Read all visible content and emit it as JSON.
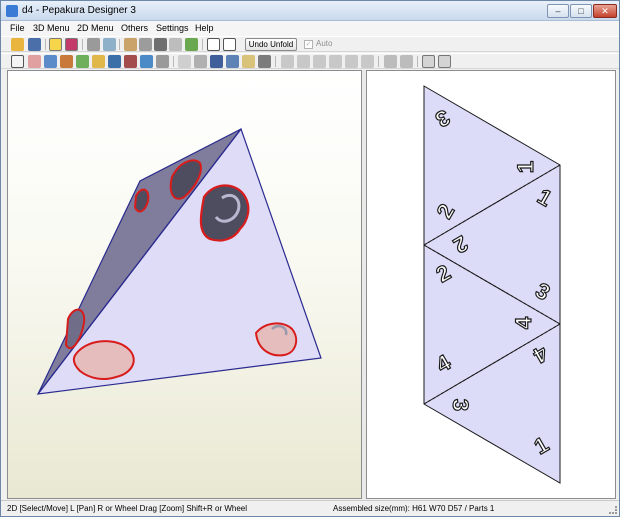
{
  "window": {
    "title": "d4 - Pepakura Designer 3",
    "min_label": "–",
    "max_label": "□",
    "close_label": "✕"
  },
  "menu": {
    "items": [
      "File",
      "3D Menu",
      "2D Menu",
      "Others",
      "Settings",
      "Help"
    ]
  },
  "toolbar": {
    "undo_label": "Undo Unfold",
    "auto_label": "Auto",
    "auto_checked": true
  },
  "status": {
    "left": "2D [Select/Move] L [Pan] R or Wheel Drag [Zoom] Shift+R or Wheel",
    "right": "Assembled size(mm): H61 W70 D57 / Parts 1"
  },
  "model2d": {
    "numbers": [
      "3",
      "1",
      "1",
      "2",
      "2",
      "2",
      "3",
      "4",
      "4",
      "4",
      "3",
      "1"
    ]
  },
  "colors": {
    "face_fill": "#dcdcf8",
    "edge": "#2b2b8f",
    "cut_outline": "#d81c1c",
    "dark_face": "#7c7a9c"
  }
}
